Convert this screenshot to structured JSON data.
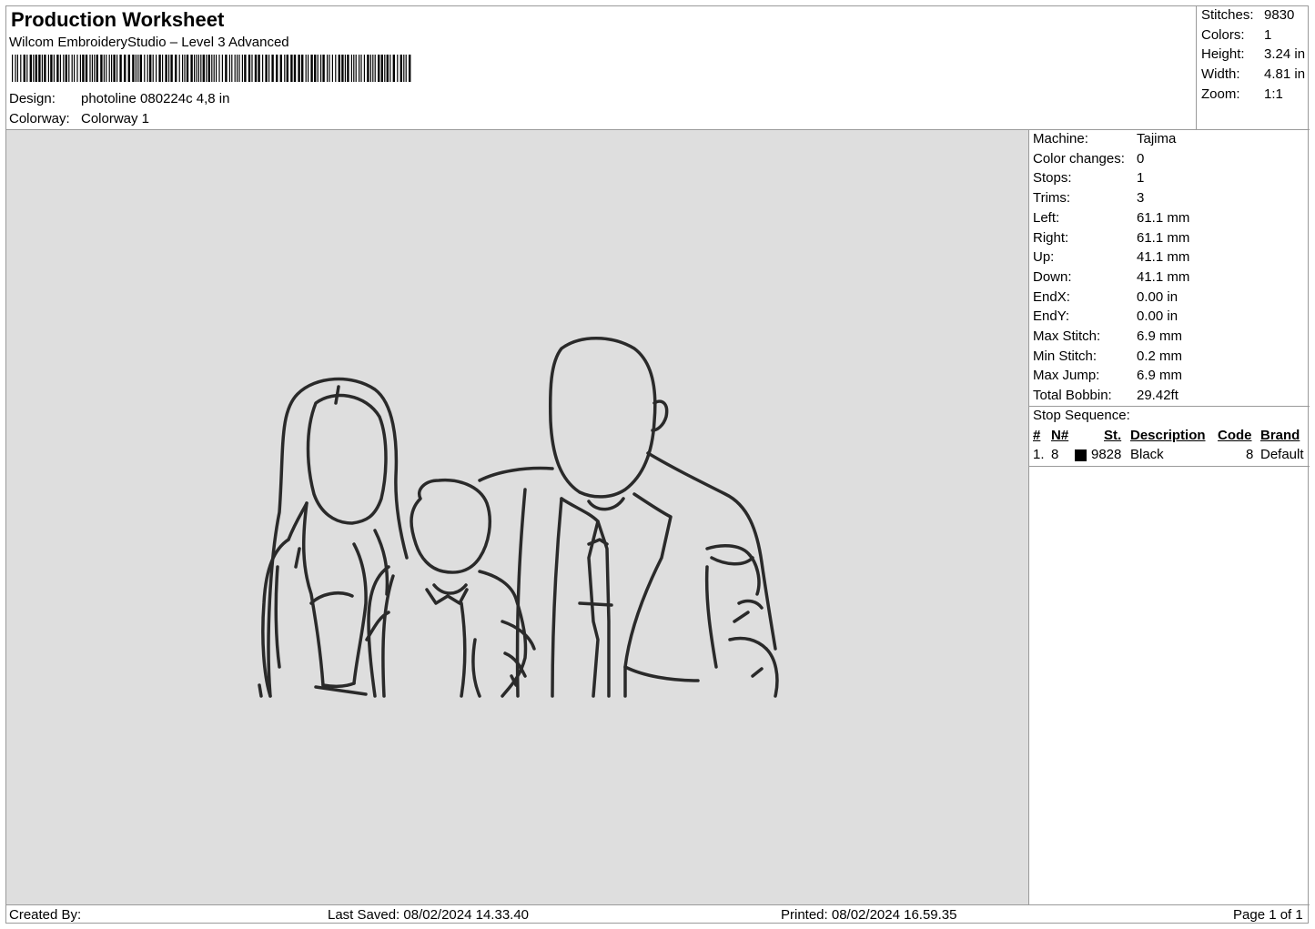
{
  "header": {
    "title": "Production Worksheet",
    "software": "Wilcom EmbroideryStudio – Level 3 Advanced",
    "design_label": "Design:",
    "design_value": "photoline 080224c 4,8 in",
    "colorway_label": "Colorway:",
    "colorway_value": "Colorway 1"
  },
  "stats": {
    "stitches_label": "Stitches:",
    "stitches_value": "9830",
    "colors_label": "Colors:",
    "colors_value": "1",
    "height_label": "Height:",
    "height_value": "3.24 in",
    "width_label": "Width:",
    "width_value": "4.81 in",
    "zoom_label": "Zoom:",
    "zoom_value": "1:1"
  },
  "properties": [
    {
      "label": "Machine:",
      "value": "Tajima"
    },
    {
      "label": "Color changes:",
      "value": "0"
    },
    {
      "label": "Stops:",
      "value": "1"
    },
    {
      "label": "Trims:",
      "value": "3"
    },
    {
      "label": "Left:",
      "value": "61.1 mm"
    },
    {
      "label": "Right:",
      "value": "61.1 mm"
    },
    {
      "label": "Up:",
      "value": "41.1 mm"
    },
    {
      "label": "Down:",
      "value": "41.1 mm"
    },
    {
      "label": "EndX:",
      "value": "0.00 in"
    },
    {
      "label": "EndY:",
      "value": "0.00 in"
    },
    {
      "label": "Max Stitch:",
      "value": "6.9 mm"
    },
    {
      "label": "Min Stitch:",
      "value": "0.2 mm"
    },
    {
      "label": "Max Jump:",
      "value": "6.9 mm"
    },
    {
      "label": "Total Bobbin:",
      "value": "29.42ft"
    }
  ],
  "stop_sequence": {
    "title": "Stop Sequence:",
    "headers": {
      "num": "#",
      "needle": "N#",
      "stitches": "St.",
      "description": "Description",
      "code": "Code",
      "brand": "Brand"
    },
    "rows": [
      {
        "num": "1.",
        "needle": "8",
        "swatch_color": "#000000",
        "stitches": "9828",
        "description": "Black",
        "code": "8",
        "brand": "Default"
      }
    ]
  },
  "footer": {
    "created_by": "Created By:",
    "last_saved": "Last Saved: 08/02/2024 14.33.40",
    "printed": "Printed: 08/02/2024 16.59.35",
    "page": "Page 1 of 1"
  },
  "colors": {
    "canvas_bg": "#dedede",
    "thread": "#2a2a2a",
    "border": "#9a9a9a"
  }
}
